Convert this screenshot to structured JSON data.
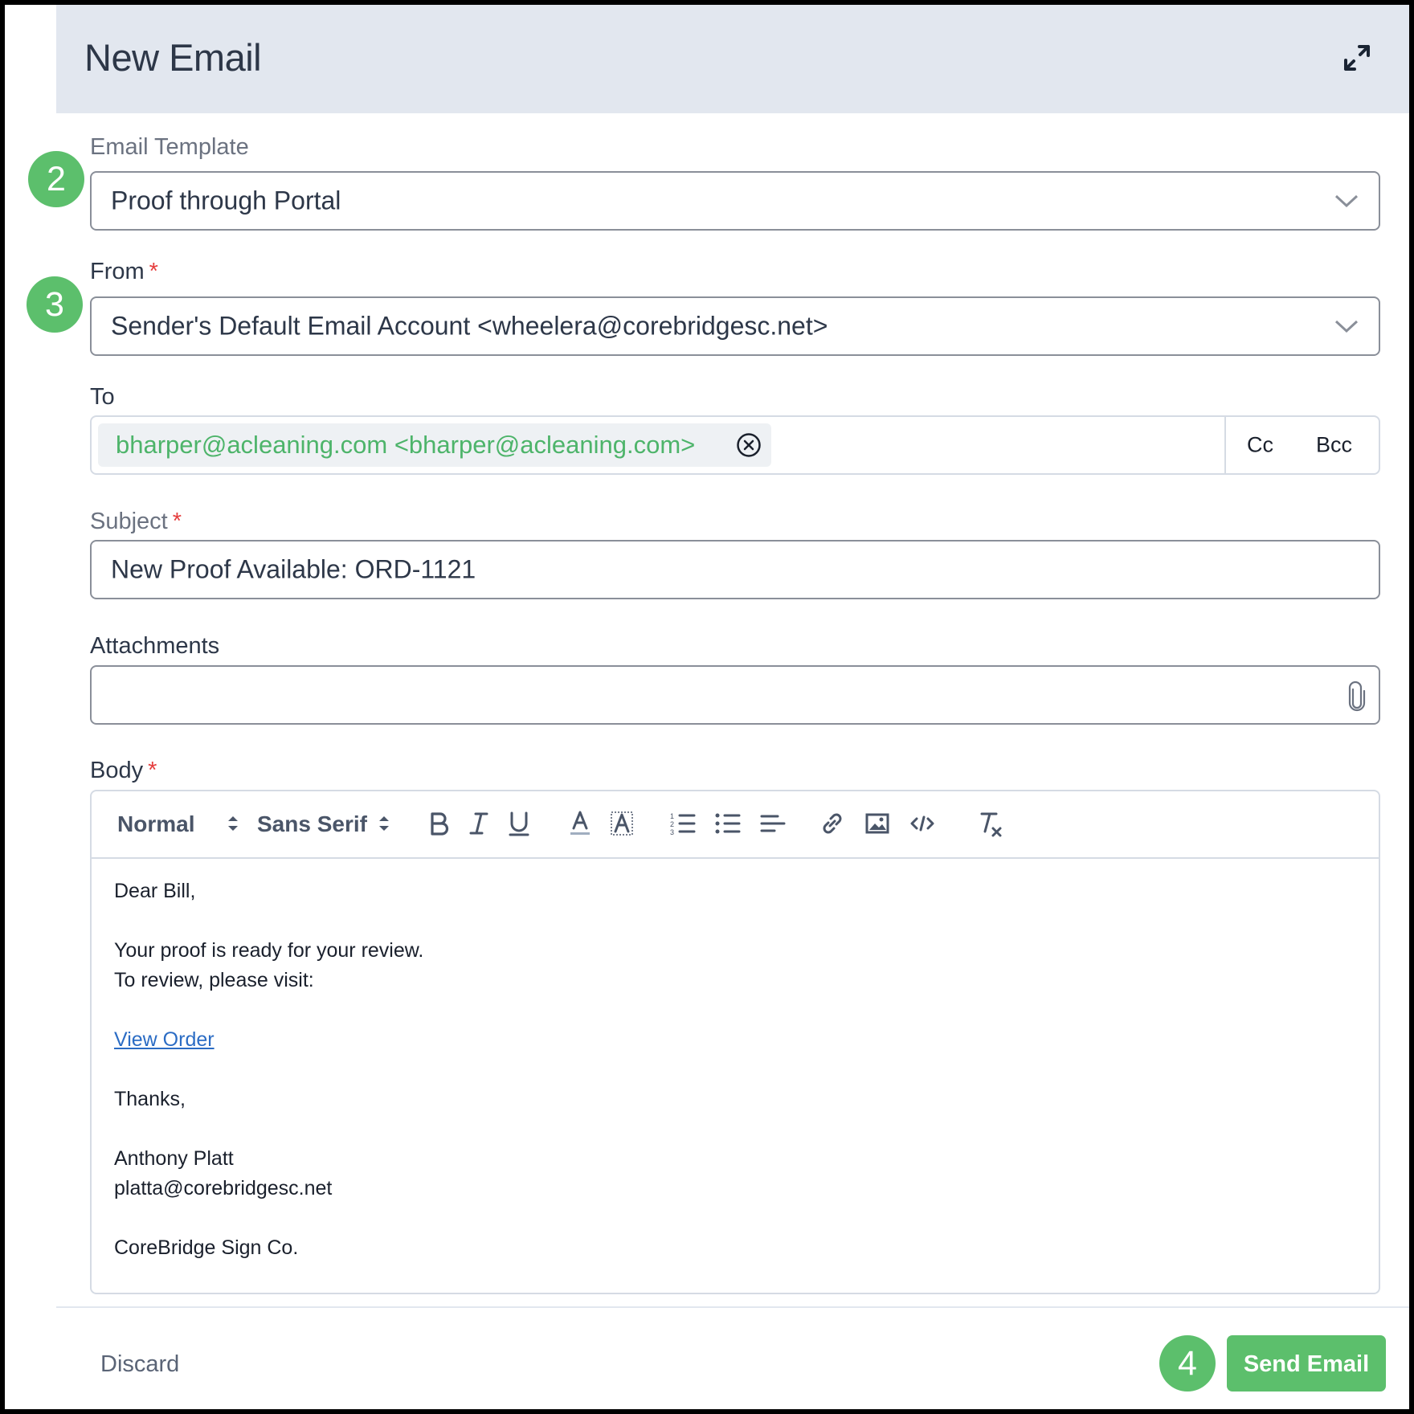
{
  "header": {
    "title": "New Email",
    "expand_icon": "expand-icon"
  },
  "badges": {
    "b2": "2",
    "b3": "3",
    "b4": "4"
  },
  "template": {
    "label": "Email Template",
    "value": "Proof through Portal"
  },
  "from": {
    "label": "From",
    "required": "*",
    "value": "Sender's Default Email Account <wheelera@corebridgesc.net>"
  },
  "to": {
    "label": "To",
    "recipient": "bharper@acleaning.com <bharper@acleaning.com>",
    "cc": "Cc",
    "bcc": "Bcc"
  },
  "subject": {
    "label": "Subject",
    "required": "*",
    "value": "New Proof Available: ORD-1121"
  },
  "attachments": {
    "label": "Attachments",
    "icon": "paperclip-icon"
  },
  "body": {
    "label": "Body",
    "required": "*",
    "toolbar": {
      "size": "Normal",
      "font": "Sans Serif"
    },
    "lines": {
      "l1": "Dear Bill,",
      "l2": "Your proof is ready for your review.",
      "l3": "To review, please visit:",
      "link": "View Order",
      "l5": "Thanks,",
      "l6": "Anthony Platt",
      "l7": "platta@corebridgesc.net",
      "l8": "CoreBridge Sign Co."
    }
  },
  "footer": {
    "discard": "Discard",
    "send": "Send Email"
  },
  "colors": {
    "accent_green": "#5cbf6c",
    "header_bg": "#e2e7ef",
    "required_red": "#e53e3e",
    "link_blue": "#2b6cc4"
  }
}
